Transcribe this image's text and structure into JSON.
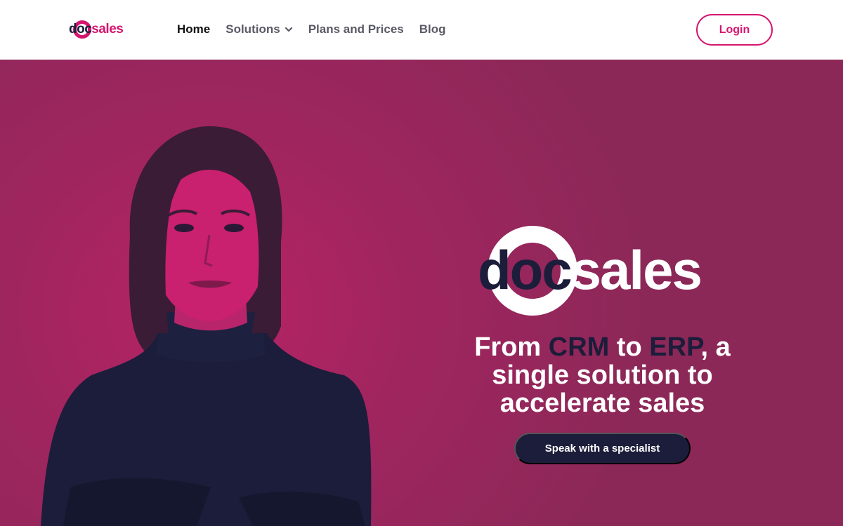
{
  "header": {
    "logo": {
      "part1": "do",
      "part2": "c",
      "part3": "sales"
    },
    "nav": [
      {
        "label": "Home"
      },
      {
        "label": "Solutions"
      },
      {
        "label": "Plans and Prices"
      },
      {
        "label": "Blog"
      }
    ],
    "login_label": "Login"
  },
  "hero": {
    "logo": {
      "part1": "doc",
      "part2": "sales"
    },
    "headline": {
      "seg1": "From ",
      "seg2": "CRM",
      "seg3": " to ",
      "seg4": "ERP",
      "seg5": ", a single solution to accelerate sales"
    },
    "cta_label": "Speak with a specialist"
  },
  "colors": {
    "brand_pink": "#d4166f",
    "navy": "#1b1d3a",
    "hero_bg": "#9a2660"
  },
  "icons": {
    "solutions_dropdown": "chevron-down-icon"
  }
}
